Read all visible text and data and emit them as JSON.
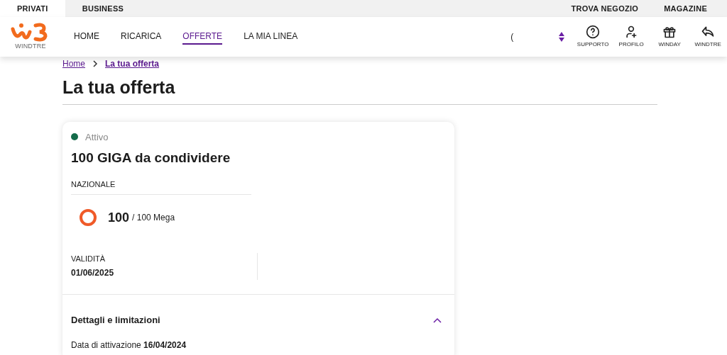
{
  "top_tabs": [
    {
      "label": "PRIVATI",
      "selected": true
    },
    {
      "label": "BUSINESS",
      "selected": false
    }
  ],
  "top_links": [
    "TROVA NEGOZIO",
    "MAGAZINE"
  ],
  "logo": {
    "text": "WINDTRE"
  },
  "nav": [
    {
      "label": "HOME",
      "selected": false
    },
    {
      "label": "RICARICA",
      "selected": false
    },
    {
      "label": "OFFERTE",
      "selected": true
    },
    {
      "label": "LA MIA LINEA",
      "selected": false
    }
  ],
  "search_fragment": "(",
  "actions": [
    {
      "kind": "help",
      "label": "SUPPORTO"
    },
    {
      "kind": "user",
      "label": "PROFILO"
    },
    {
      "kind": "gift",
      "label": "WINDAY"
    },
    {
      "kind": "back",
      "label": "WINDTRE"
    }
  ],
  "breadcrumb": [
    "Home",
    "La tua offerta"
  ],
  "page_title": "La tua offerta",
  "offer": {
    "status": {
      "label": "Attivo",
      "color": "#146b4a"
    },
    "title": "100 GIGA da condividere",
    "section": "NAZIONALE",
    "usage": {
      "value": "100",
      "total": "/ 100 Mega",
      "level": 1
    },
    "validity_label": "VALIDITÀ",
    "validity_date": "01/06/2025",
    "details": {
      "title": "Dettagli e limitazioni",
      "expanded": true,
      "activation_label": "Data di attivazione",
      "activation_date": "16/04/2024"
    }
  }
}
